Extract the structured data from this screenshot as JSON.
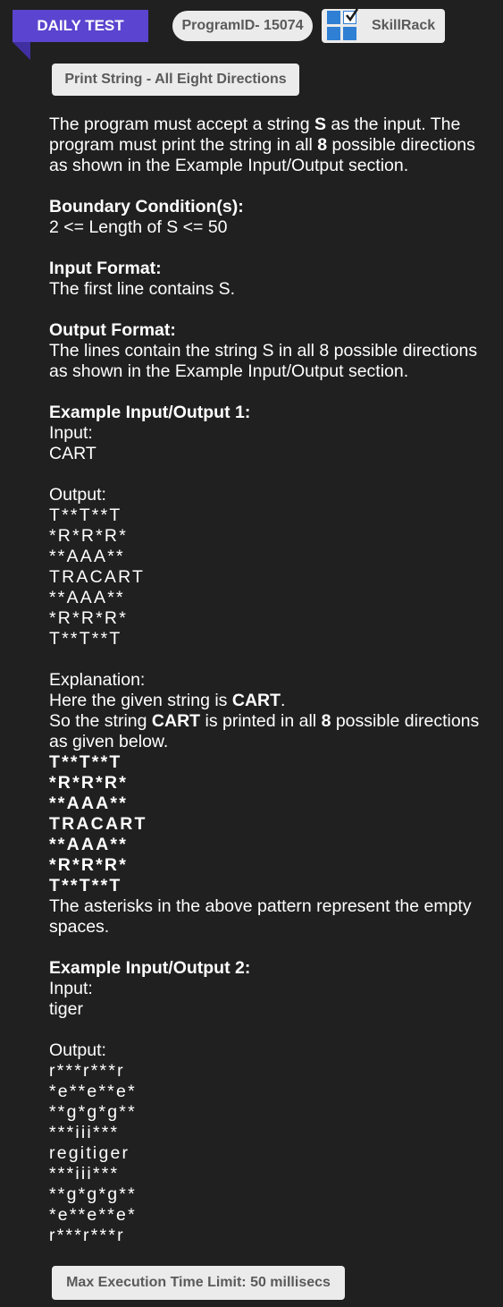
{
  "header": {
    "daily_test": "DAILY TEST",
    "program_id": "ProgramID- 15074",
    "brand": "SkillRack"
  },
  "title": "Print String - All Eight Directions",
  "description": {
    "p1_a": "The program must accept a string ",
    "p1_s": "S",
    "p1_b": " as the input. The program must print the string in all ",
    "p1_8": "8",
    "p1_c": " possible directions as shown in the Example Input/Output section."
  },
  "boundary": {
    "heading": "Boundary Condition(s):",
    "text": "2 <= Length of S <= 50"
  },
  "input_format": {
    "heading": "Input Format:",
    "text": "The first line contains S."
  },
  "output_format": {
    "heading": "Output Format:",
    "text": "The lines contain the string S in all 8 possible directions as shown in the Example Input/Output section."
  },
  "example1": {
    "heading": "Example Input/Output 1:",
    "input_label": "Input:",
    "input": "CART",
    "output_label": "Output:",
    "output": [
      "T**T**T",
      "*R*R*R*",
      "**AAA**",
      "TRACART",
      "**AAA**",
      "*R*R*R*",
      "T**T**T"
    ],
    "explanation_label": "Explanation:",
    "exp1_a": "Here the given string is ",
    "exp1_b": "CART",
    "exp1_c": ".",
    "exp2_a": "So the string ",
    "exp2_b": "CART",
    "exp2_c": " is printed in all ",
    "exp2_d": "8",
    "exp2_e": " possible directions as given below.",
    "pattern": [
      "T**T**T",
      "*R*R*R*",
      "**AAA**",
      "TRACART",
      "**AAA**",
      "*R*R*R*",
      "T**T**T"
    ],
    "note": "The asterisks in the above pattern represent the empty spaces."
  },
  "example2": {
    "heading": "Example Input/Output 2:",
    "input_label": "Input:",
    "input": "tiger",
    "output_label": "Output:",
    "output": [
      "r***r***r",
      "*e**e**e*",
      "**g*g*g**",
      "***iii***",
      "regitiger",
      "***iii***",
      "**g*g*g**",
      "*e**e**e*",
      "r***r***r"
    ]
  },
  "footer": {
    "limit": "Max Execution Time Limit: 50 millisecs"
  },
  "colors": {
    "background": "#202020",
    "ribbon": "#5b44cf",
    "pill": "#ebebeb",
    "logo_blue": "#2f7fd4"
  }
}
